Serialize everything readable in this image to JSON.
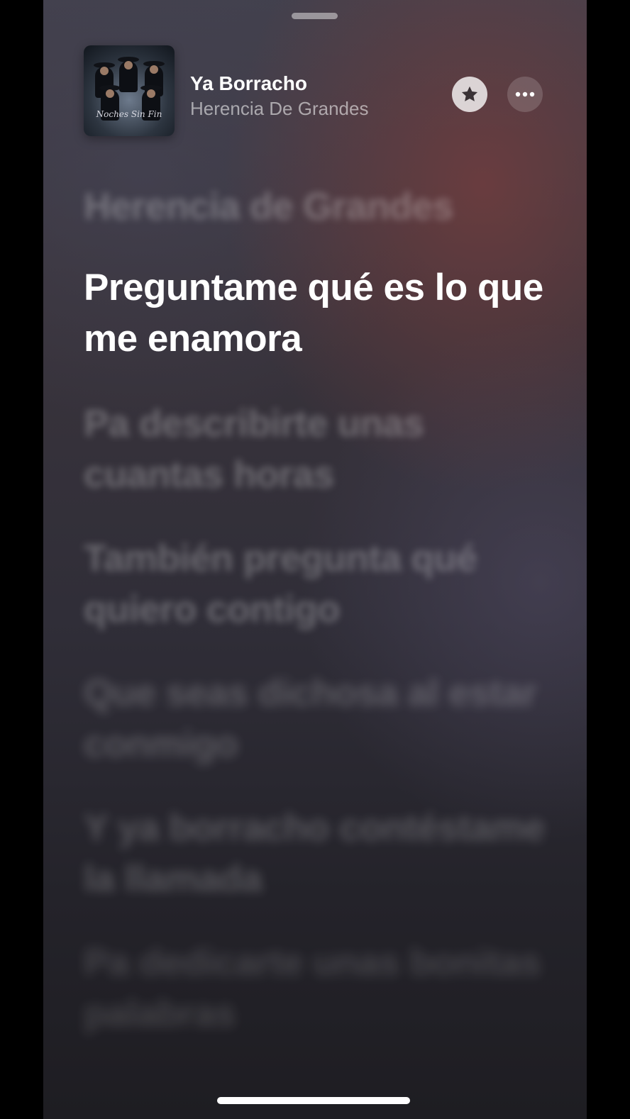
{
  "now_playing": {
    "title": "Ya Borracho",
    "artist": "Herencia De Grandes",
    "artwork_text": "Noches Sin Fin"
  },
  "actions": {
    "favorite_icon": "star-icon",
    "more_icon": "ellipsis-icon"
  },
  "lyrics": {
    "previous": "Herencia de Grandes",
    "current": "Preguntame qué es lo que me enamora",
    "upcoming": [
      "Pa describirte unas cuantas horas",
      "También pregunta qué quiero contigo",
      "Que seas dichosa al estar conmigo",
      "Y ya borracho contéstame la llamada",
      "Pa dedicarte unas bonitas palabras"
    ]
  },
  "colors": {
    "background_top": "#42404c",
    "background_bottom": "#1e1d22",
    "accent_glow": "#783e3e",
    "active_lyric": "#ffffff"
  }
}
